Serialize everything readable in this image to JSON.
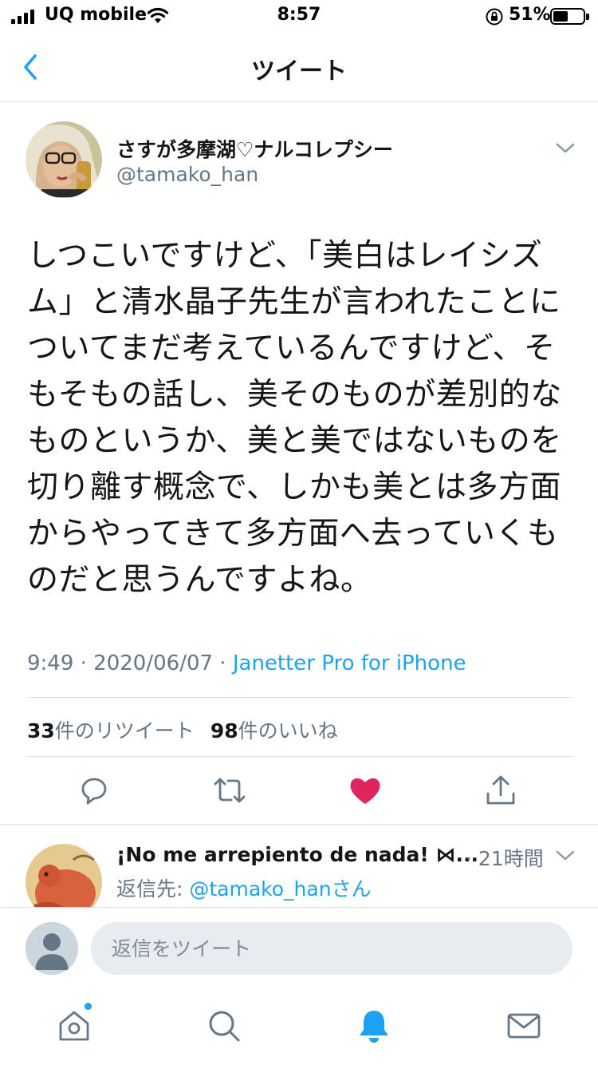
{
  "status_bar": {
    "carrier": "UQ mobile",
    "time": "8:57",
    "battery_percent": "51%",
    "battery_level": 0.51
  },
  "nav": {
    "title": "ツイート",
    "back_icon": "chevron-left-icon"
  },
  "tweet": {
    "author_name": "さすが多摩湖♡ナルコレプシー",
    "author_handle": "@tamako_han",
    "text": "しつこいですけど、「美白はレイシズム」と清水晶子先生が言われたことについてまだ考えているんですけど、そもそもの話し、美そのものが差別的なものというか、美と美ではないものを切り離す概念で、しかも美とは多方面からやってきて多方面へ去っていくものだと思うんですよね。",
    "time": "9:49 · 2020/06/07 · ",
    "source": "Janetter Pro for iPhone",
    "retweet_count": "33",
    "retweet_label": "件のリツイート",
    "like_count": "98",
    "like_label": "件のいいね",
    "liked": true
  },
  "actions": [
    "reply-icon",
    "retweet-icon",
    "like-icon",
    "share-icon"
  ],
  "reply": {
    "author_name": "¡No me arrepiento de nada! ⋈...",
    "time": "· 21時間",
    "reply_to_label": "返信先: ",
    "reply_to_handle": "@tamako_han",
    "reply_to_suffix": "さん"
  },
  "composer": {
    "placeholder": "返信をツイート"
  },
  "tabbar": [
    "home-icon",
    "search-icon",
    "notifications-icon",
    "messages-icon"
  ],
  "colors": {
    "accent": "#1da1f2",
    "like": "#e0245e",
    "text": "#14171a",
    "secondary": "#657786"
  }
}
